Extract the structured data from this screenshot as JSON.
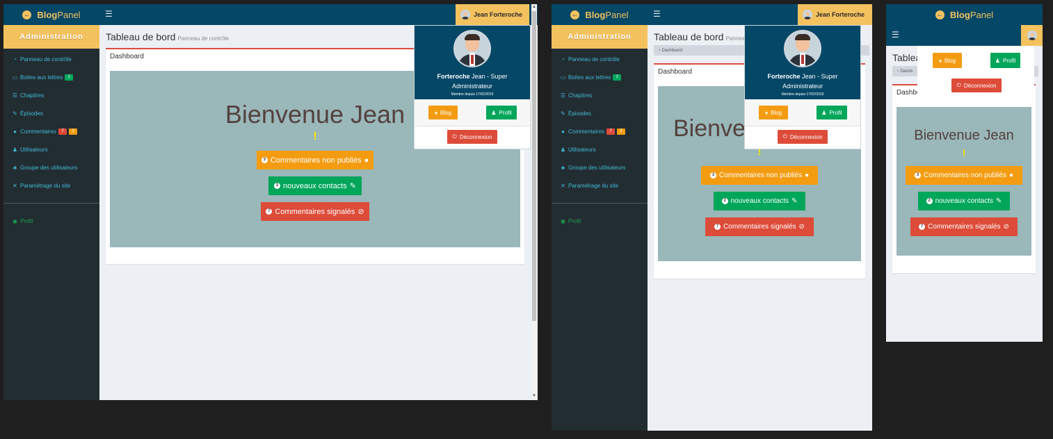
{
  "brand": {
    "part1": "Blog",
    "part2": "Panel"
  },
  "user": {
    "name": "Jean Forteroche",
    "last": "Forteroche",
    "role_line1": "Jean - Super",
    "role_line2": "Administrateur",
    "since": "Membre depuis 17/02/2019"
  },
  "sidebar": {
    "header": "Administration",
    "items": [
      {
        "label": "Panneau de contrôle",
        "icon": "dashboard-icon"
      },
      {
        "label": "Boites aux lettres",
        "icon": "mailbox-icon",
        "badge": "2"
      },
      {
        "label": "Chapitres",
        "icon": "list-icon"
      },
      {
        "label": "Épisodes",
        "icon": "edit-icon"
      },
      {
        "label": "Commentaires",
        "icon": "comment-icon",
        "badge_red": "7",
        "badge_orange": "3"
      },
      {
        "label": "Utilisateurs",
        "icon": "user-icon"
      },
      {
        "label": "Groupe des utilisateurs",
        "icon": "users-icon"
      },
      {
        "label": "Paramétrage du site",
        "icon": "tools-icon"
      }
    ],
    "profile": "Profil"
  },
  "main": {
    "title": "Tableau de bord",
    "subtitle": "Panneau de contrôle",
    "subtitle_short": "Panneau",
    "crumb": "Dashboard",
    "crumb_short": "Dashb",
    "box_title": "Dashboard",
    "box_title_short": "Dashbo",
    "welcome": "Bienvenue Jean",
    "welcome_short": "Bienve",
    "exclaim": "!",
    "btn_unpublished": "Commentaires non publiés",
    "btn_unpublished_count": "3",
    "btn_contacts": "nouveaux contacts",
    "btn_contacts_count": "2",
    "btn_reported": "Commentaires signalés",
    "btn_reported_count": "7"
  },
  "menu": {
    "blog": "Blog",
    "profil": "Profil",
    "logout": "Déconnexion"
  },
  "title_short": "Tablea",
  "colors": {
    "topbar": "#054766",
    "accent": "#f3c15e",
    "sidebar": "#222d32",
    "welcome_bg": "#9ab7ba"
  }
}
